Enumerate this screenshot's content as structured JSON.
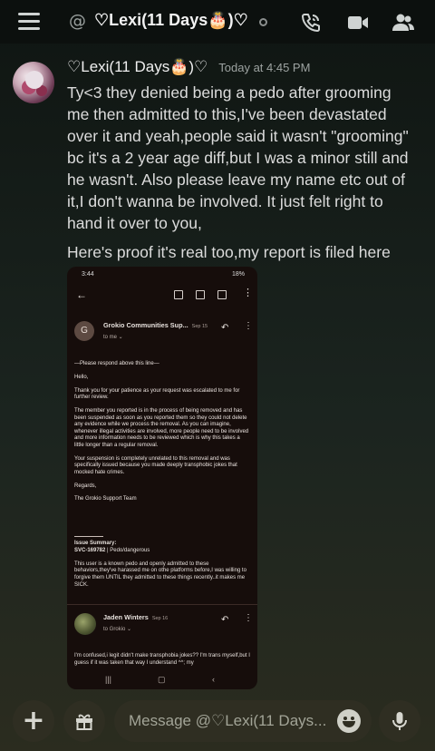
{
  "header": {
    "at_symbol": "@",
    "title": "♡Lexi(11 Days🎂)♡"
  },
  "message": {
    "username": "♡Lexi(11 Days🎂)♡",
    "timestamp": "Today at 4:45 PM",
    "text": "Ty<3 they denied being a pedo after  grooming me then admitted to this,I've been devastated over it and yeah,people said it wasn't \"grooming\" bc it's a 2 year age diff,but I was a minor still and he wasn't. Also please leave my name etc out of it,I don't wanna be involved. It just felt right to hand it over to you,",
    "text2": "Here's proof it's real too,my report is filed here"
  },
  "attachment": {
    "status_time": "3:44",
    "status_right": "18%",
    "sender_initial": "G",
    "sender": "Grokio Communities Sup...",
    "sender_date": "Sep 15",
    "to": "to me ⌄",
    "body": [
      "—Please respond above this line—",
      "Hello,",
      "Thank you for your patience as your request was escalated to me for further review.",
      "The member you reported is in the process of being removed and has been suspended as soon as you reported them so they could not delete any evidence while we process the removal. As you can imagine, whenever illegal activities are involved, more people need to be involved and more information needs to be reviewed which is why this takes a little longer than a regular removal.",
      "Your suspension is completely unrelated to this removal and was specifically issued because you made deeply transphobic jokes that mocked hate crimes.",
      "Regards,",
      "The Grokio Support Team"
    ],
    "issue_title": "Issue Summary:",
    "issue_id": "SVC-169782",
    "issue_type": "| Pedo/dangerous",
    "issue_text": "This user is a known pedo and openly admitted to these behaviors,they've harassed me on othe platforms before,I was willing to forgive them UNTIL they admitted to these things recently..it makes me SICK.",
    "reply_name": "Jaden Winters",
    "reply_date": "Sep 16",
    "reply_to": "to Grokio ⌄",
    "reply_body": "I'm confused,i legit didn't make transphobia jokes?? I'm trans myself,but I guess if it was taken that way I understand ^^; my"
  },
  "composer": {
    "placeholder": "Message @♡Lexi(11 Days..."
  },
  "icons": [
    "menu-icon",
    "call-icon",
    "video-icon",
    "members-icon",
    "plus-icon",
    "gift-icon",
    "emoji-icon",
    "mic-icon"
  ]
}
